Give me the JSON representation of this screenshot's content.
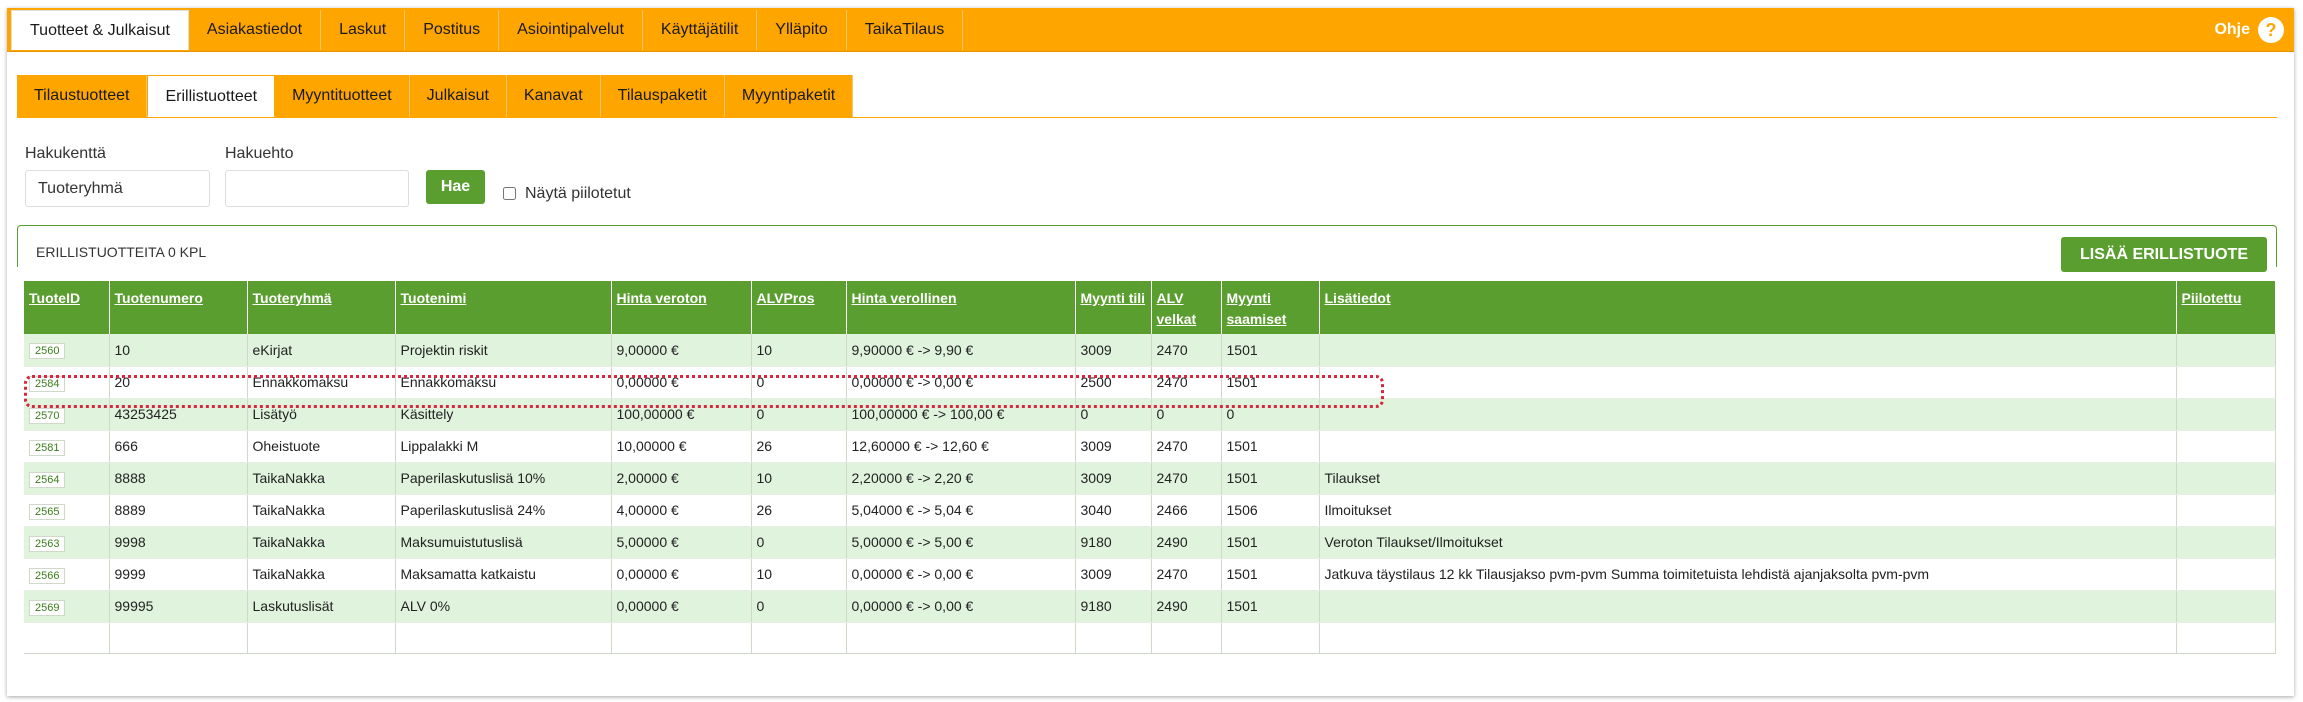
{
  "topnav": {
    "tabs": [
      {
        "label": "Tuotteet & Julkaisut",
        "active": true
      },
      {
        "label": "Asiakastiedot"
      },
      {
        "label": "Laskut"
      },
      {
        "label": "Postitus"
      },
      {
        "label": "Asiointipalvelut"
      },
      {
        "label": "Käyttäjätilit"
      },
      {
        "label": "Ylläpito"
      },
      {
        "label": "TaikaTilaus"
      }
    ],
    "help_label": "Ohje",
    "help_icon": "?"
  },
  "subtabs": [
    {
      "label": "Tilaustuotteet"
    },
    {
      "label": "Erillistuotteet",
      "active": true
    },
    {
      "label": "Myyntituotteet"
    },
    {
      "label": "Julkaisut"
    },
    {
      "label": "Kanavat"
    },
    {
      "label": "Tilauspaketit"
    },
    {
      "label": "Myyntipaketit"
    }
  ],
  "search": {
    "field_label": "Hakukenttä",
    "field_value": "Tuoteryhmä",
    "criteria_label": "Hakuehto",
    "criteria_value": "",
    "search_button": "Hae",
    "show_hidden_label": "Näytä piilotetut"
  },
  "panel": {
    "title": "ERILLISTUOTTEITA 0 KPL",
    "add_button": "LISÄÄ ERILLISTUOTE"
  },
  "table": {
    "headers": [
      "TuoteID",
      "Tuotenumero",
      "Tuoteryhmä",
      "Tuotenimi",
      "Hinta veroton",
      "ALVPros",
      "Hinta verollinen",
      "Myynti tili",
      "ALV velkat",
      "Myynti saamiset",
      "Lisätiedot",
      "Piilotettu"
    ],
    "rows": [
      [
        "2560",
        "10",
        "eKirjat",
        "Projektin riskit",
        "9,00000 €",
        "10",
        "9,90000 € -> 9,90 €",
        "3009",
        "2470",
        "1501",
        "",
        ""
      ],
      [
        "2584",
        "20",
        "Ennakkomaksu",
        "Ennakkomaksu",
        "0,00000 €",
        "0",
        "0,00000 € -> 0,00 €",
        "2500",
        "2470",
        "1501",
        "",
        ""
      ],
      [
        "2570",
        "43253425",
        "Lisätyö",
        "Käsittely",
        "100,00000 €",
        "0",
        "100,00000 € -> 100,00 €",
        "0",
        "0",
        "0",
        "",
        ""
      ],
      [
        "2581",
        "666",
        "Oheistuote",
        "Lippalakki M",
        "10,00000 €",
        "26",
        "12,60000 € -> 12,60 €",
        "3009",
        "2470",
        "1501",
        "",
        ""
      ],
      [
        "2564",
        "8888",
        "TaikaNakka",
        "Paperilaskutuslisä 10%",
        "2,00000 €",
        "10",
        "2,20000 € -> 2,20 €",
        "3009",
        "2470",
        "1501",
        "Tilaukset",
        ""
      ],
      [
        "2565",
        "8889",
        "TaikaNakka",
        "Paperilaskutuslisä 24%",
        "4,00000 €",
        "26",
        "5,04000 € -> 5,04 €",
        "3040",
        "2466",
        "1506",
        "Ilmoitukset",
        ""
      ],
      [
        "2563",
        "9998",
        "TaikaNakka",
        "Maksumuistutuslisä",
        "5,00000 €",
        "0",
        "5,00000 € -> 5,00 €",
        "9180",
        "2490",
        "1501",
        "Veroton Tilaukset/Ilmoitukset",
        ""
      ],
      [
        "2566",
        "9999",
        "TaikaNakka",
        "Maksamatta katkaistu",
        "0,00000 €",
        "10",
        "0,00000 € -> 0,00 €",
        "3009",
        "2470",
        "1501",
        "Jatkuva täystilaus 12 kk Tilausjakso pvm-pvm Summa toimitetuista lehdistä ajanjaksolta pvm-pvm",
        ""
      ],
      [
        "2569",
        "99995",
        "Laskutuslisät",
        "ALV 0%",
        "0,00000 €",
        "0",
        "0,00000 € -> 0,00 €",
        "9180",
        "2490",
        "1501",
        "",
        ""
      ]
    ]
  },
  "colors": {
    "nav_orange": "#ffa500",
    "accent_green": "#5a9e2f",
    "row_alt": "#dff3dd",
    "highlight_red": "#d7263d"
  }
}
